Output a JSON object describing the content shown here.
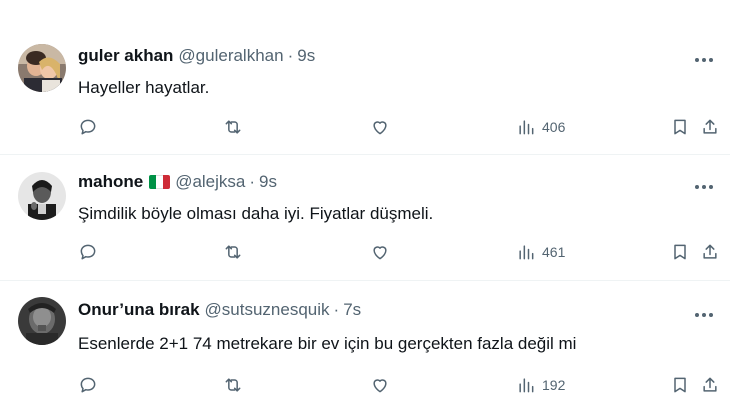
{
  "tweets": [
    {
      "name": "guler akhan",
      "handle": "@guleralkhan",
      "separator": "·",
      "time": "9s",
      "text": "Hayeller hayatlar.",
      "views": "406",
      "has_flag": false
    },
    {
      "name": "mahone",
      "handle": "@alejksa",
      "separator": "·",
      "time": "9s",
      "text": "Şimdilik böyle olması daha iyi. Fiyatlar düşmeli.",
      "views": "461",
      "has_flag": true,
      "flag_colors": [
        "#009246",
        "#ffffff",
        "#ce2b37"
      ]
    },
    {
      "name": "Onur’una bırak",
      "handle": "@sutsuznesquik",
      "separator": "·",
      "time": "7s",
      "text": "Esenlerde 2+1 74 metrekare bir ev için bu gerçekten fazla değil mi",
      "views": "192",
      "has_flag": false
    }
  ],
  "icons": {
    "more": "more-horizontal-icon",
    "reply": "reply-icon",
    "retweet": "retweet-icon",
    "like": "heart-icon",
    "views": "views-bar-chart-icon",
    "bookmark": "bookmark-icon",
    "share": "share-icon"
  },
  "colors": {
    "primary_text": "#0f1419",
    "secondary_text": "#536471",
    "divider": "#eff3f4"
  }
}
